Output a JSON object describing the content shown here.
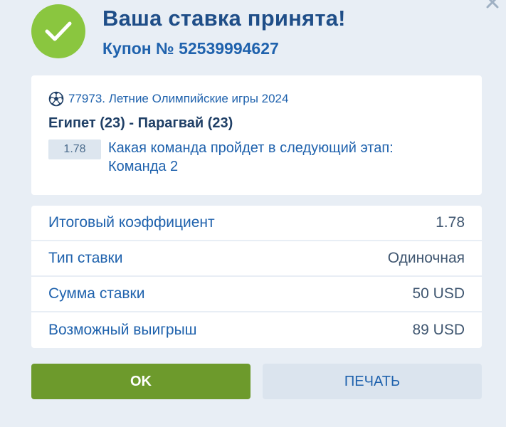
{
  "header": {
    "title": "Ваша ставка принята!",
    "coupon": "Купон № 52539994627"
  },
  "bet": {
    "event": "77973. Летние Олимпийские игры 2024",
    "match": "Египет (23) - Парагвай (23)",
    "odd": "1.78",
    "outcome": "Какая команда пройдет в следующий этап: Команда 2"
  },
  "summary": {
    "rows": [
      {
        "label": "Итоговый коэффициент",
        "value": "1.78"
      },
      {
        "label": "Тип ставки",
        "value": "Одиночная"
      },
      {
        "label": "Сумма ставки",
        "value": "50 USD"
      },
      {
        "label": "Возможный выигрыш",
        "value": "89 USD"
      }
    ]
  },
  "buttons": {
    "ok": "OK",
    "print": "ПЕЧАТЬ"
  },
  "icons": {
    "success": "check-icon",
    "sport": "soccer-ball-icon",
    "close": "close-icon"
  },
  "colors": {
    "success_green": "#8ac63f",
    "ok_button": "#6d9a2c",
    "accent_blue": "#1f62ad",
    "background": "#e8eef5"
  }
}
